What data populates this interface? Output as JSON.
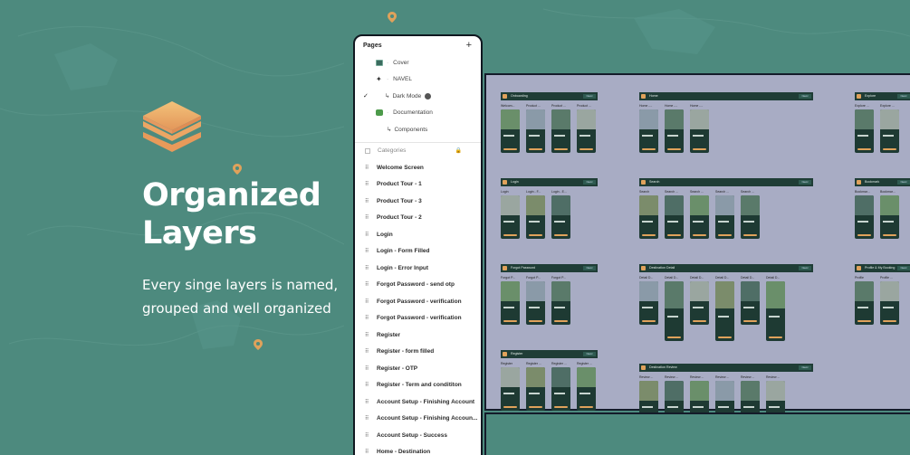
{
  "hero": {
    "title_line1": "Organized",
    "title_line2": "Layers",
    "subtitle_line1": "Every singe layers is named,",
    "subtitle_line2": "grouped and well organized"
  },
  "colors": {
    "background": "#4d8a7e",
    "accent": "#e0a25b",
    "panel_border": "#101820",
    "canvas": "#a8acc4",
    "screen_dark": "#1e3a33"
  },
  "panel": {
    "pages_label": "Pages",
    "add_icon": "plus-icon",
    "pages": [
      {
        "label": "Cover",
        "icon": "image-icon"
      },
      {
        "label": "NAVEL",
        "icon": "sparkle-icon"
      },
      {
        "label": "Dark Mode",
        "icon": "return-arrow-icon",
        "checked": true
      },
      {
        "label": "Documentation",
        "icon": "puzzle-icon"
      },
      {
        "label": "Components",
        "icon": "return-arrow-icon"
      }
    ],
    "categories_label": "Categories",
    "layers": [
      "Welcome Screen",
      "Product Tour - 1",
      "Product Tour - 3",
      "Product Tour - 2",
      "Login",
      "Login - Form Filled",
      "Login - Error Input",
      "Forgot Password - send otp",
      "Forgot Password - verification",
      "Forgot Password - verification",
      "Register",
      "Register - form filled",
      "Register - OTP",
      "Register - Term and condititon",
      "Account Setup - Finishing Account",
      "Account Setup - Finishing Accoun...",
      "Account Setup - Success",
      "Home - Destination"
    ]
  },
  "canvas": {
    "sections": [
      {
        "title": "Onboarding",
        "button": "Navel",
        "labels": [
          "Welcom...",
          "Product ...",
          "Product ...",
          "Product ..."
        ]
      },
      {
        "title": "Home",
        "button": "Navel",
        "labels": [
          "Home -...",
          "Home -...",
          "Home -..."
        ]
      },
      {
        "title": "Explore",
        "button": "Navel",
        "labels": [
          "Explore ...",
          "Explore ..."
        ]
      },
      {
        "title": "Login",
        "button": "Navel",
        "labels": [
          "Login",
          "Login - F...",
          "Login - E..."
        ]
      },
      {
        "title": "Search",
        "button": "Navel",
        "labels": [
          "Search",
          "Search ...",
          "Search ...",
          "Search ...",
          "Search ..."
        ]
      },
      {
        "title": "Bookmark",
        "button": "Navel",
        "labels": [
          "Bookmar...",
          "Bookmar..."
        ]
      },
      {
        "title": "Forgot Password",
        "button": "Navel",
        "labels": [
          "Forgot P...",
          "Forgot P...",
          "Forgot P..."
        ]
      },
      {
        "title": "Destination Detail",
        "button": "Navel",
        "labels": [
          "Detail D...",
          "Detail D...",
          "Detail D...",
          "Detail D...",
          "Detail D...",
          "Detail D..."
        ]
      },
      {
        "title": "Profile & My Booking",
        "button": "Navel",
        "labels": [
          "Profile",
          "Profile ..."
        ]
      },
      {
        "title": "Register",
        "button": "Navel",
        "labels": [
          "Register",
          "Register ...",
          "Register ...",
          "Register ..."
        ]
      },
      {
        "title": "Destination Review",
        "button": "Navel",
        "labels": [
          "Review ...",
          "Review ...",
          "Review ...",
          "Review ...",
          "Review ...",
          "Review ..."
        ]
      }
    ]
  }
}
